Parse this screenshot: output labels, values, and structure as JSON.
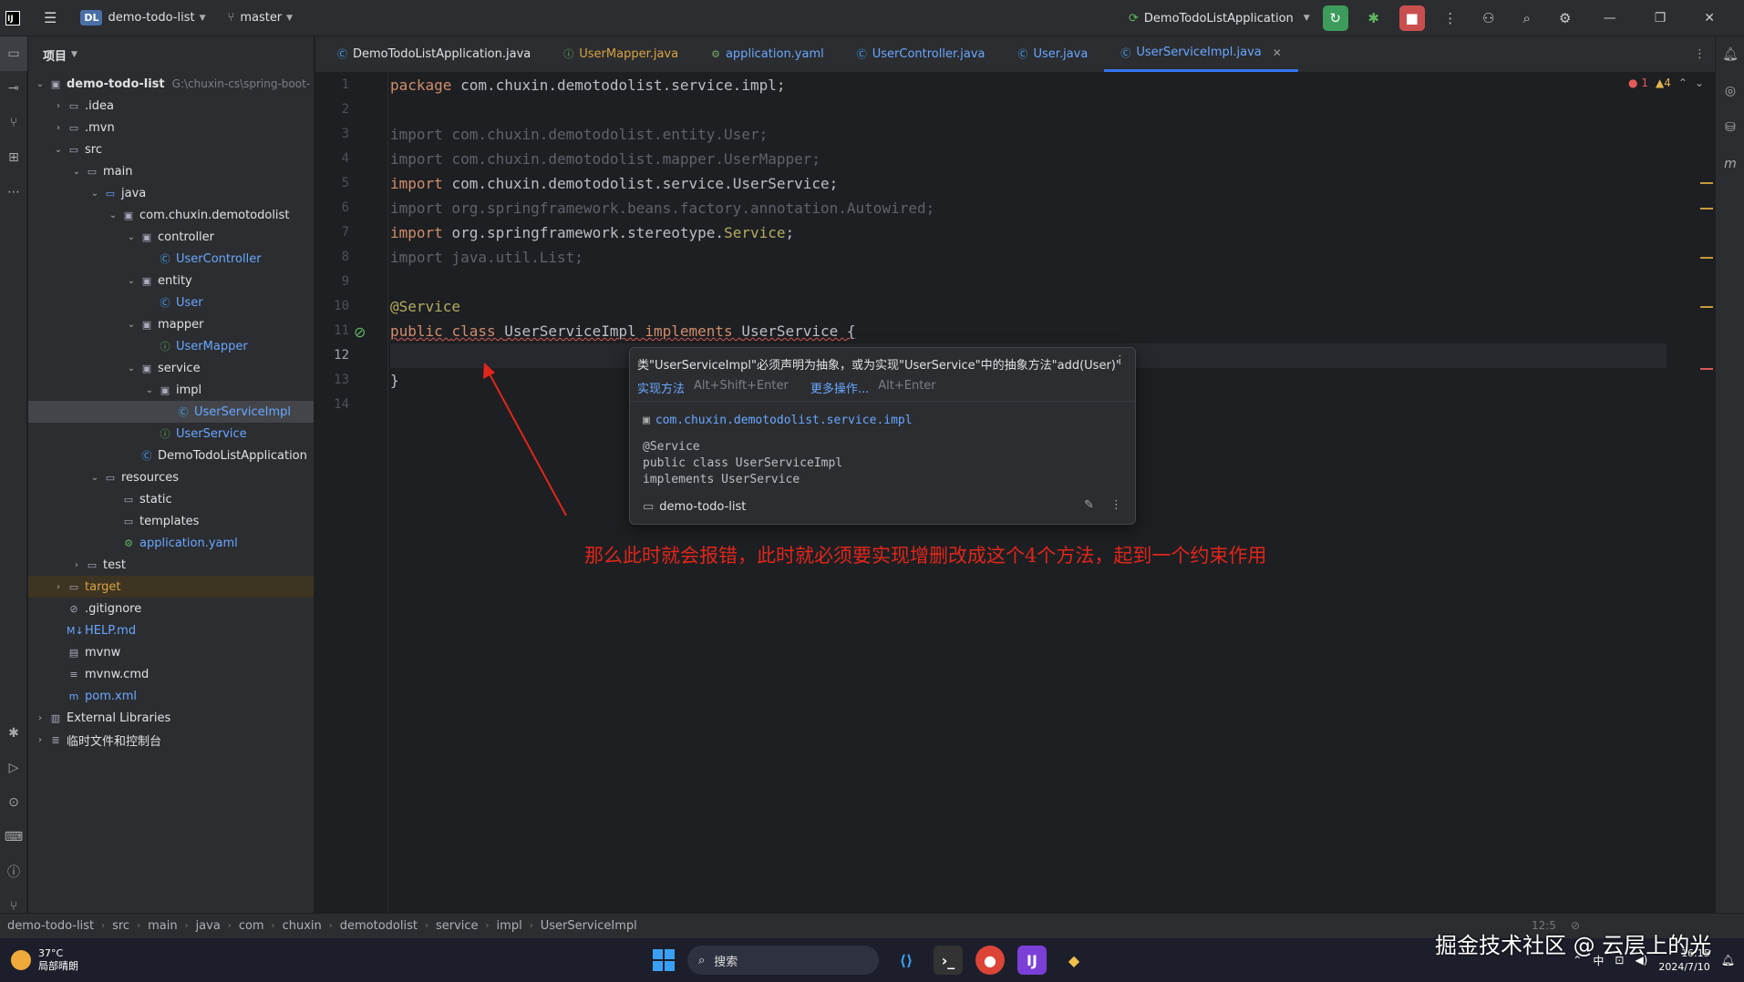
{
  "titlebar": {
    "project_badge": "DL",
    "project_name": "demo-todo-list",
    "branch": "master",
    "run_config": "DemoTodoListApplication"
  },
  "project_panel": {
    "title": "项目",
    "tree": [
      {
        "indent": 0,
        "chev": "v",
        "icon": "module-folder-icon",
        "label": "demo-todo-list",
        "extra": "G:\\chuxin-cs\\spring-boot-",
        "style": "bold"
      },
      {
        "indent": 1,
        "chev": ">",
        "icon": "folder-icon",
        "label": ".idea"
      },
      {
        "indent": 1,
        "chev": ">",
        "icon": "folder-icon",
        "label": ".mvn"
      },
      {
        "indent": 1,
        "chev": "v",
        "icon": "folder-icon",
        "label": "src"
      },
      {
        "indent": 2,
        "chev": "v",
        "icon": "folder-icon",
        "label": "main"
      },
      {
        "indent": 3,
        "chev": "v",
        "icon": "source-folder-icon",
        "label": "java"
      },
      {
        "indent": 4,
        "chev": "v",
        "icon": "package-icon",
        "label": "com.chuxin.demotodolist"
      },
      {
        "indent": 5,
        "chev": "v",
        "icon": "package-icon",
        "label": "controller"
      },
      {
        "indent": 6,
        "chev": "",
        "icon": "class-icon",
        "label": "UserController",
        "style": "blue"
      },
      {
        "indent": 5,
        "chev": "v",
        "icon": "package-icon",
        "label": "entity"
      },
      {
        "indent": 6,
        "chev": "",
        "icon": "class-icon",
        "label": "User",
        "style": "blue"
      },
      {
        "indent": 5,
        "chev": "v",
        "icon": "package-icon",
        "label": "mapper"
      },
      {
        "indent": 6,
        "chev": "",
        "icon": "interface-icon",
        "label": "UserMapper",
        "style": "blue"
      },
      {
        "indent": 5,
        "chev": "v",
        "icon": "package-icon",
        "label": "service"
      },
      {
        "indent": 6,
        "chev": "v",
        "icon": "package-icon",
        "label": "impl"
      },
      {
        "indent": 7,
        "chev": "",
        "icon": "class-icon",
        "label": "UserServiceImpl",
        "style": "blue",
        "selected": true
      },
      {
        "indent": 6,
        "chev": "",
        "icon": "interface-icon",
        "label": "UserService",
        "style": "blue"
      },
      {
        "indent": 5,
        "chev": "",
        "icon": "spring-class-icon",
        "label": "DemoTodoListApplication"
      },
      {
        "indent": 3,
        "chev": "v",
        "icon": "resources-folder-icon",
        "label": "resources"
      },
      {
        "indent": 4,
        "chev": "",
        "icon": "folder-icon",
        "label": "static"
      },
      {
        "indent": 4,
        "chev": "",
        "icon": "folder-icon",
        "label": "templates"
      },
      {
        "indent": 4,
        "chev": "",
        "icon": "yaml-icon",
        "label": "application.yaml",
        "style": "blue"
      },
      {
        "indent": 2,
        "chev": ">",
        "icon": "folder-icon",
        "label": "test"
      },
      {
        "indent": 1,
        "chev": ">",
        "icon": "folder-icon",
        "label": "target",
        "style": "orange",
        "target": true
      },
      {
        "indent": 1,
        "chev": "",
        "icon": "ignore-icon",
        "label": ".gitignore"
      },
      {
        "indent": 1,
        "chev": "",
        "icon": "markdown-icon",
        "label": "HELP.md",
        "style": "blue"
      },
      {
        "indent": 1,
        "chev": "",
        "icon": "file-icon",
        "label": "mvnw"
      },
      {
        "indent": 1,
        "chev": "",
        "icon": "text-icon",
        "label": "mvnw.cmd"
      },
      {
        "indent": 1,
        "chev": "",
        "icon": "maven-icon",
        "label": "pom.xml",
        "style": "blue"
      },
      {
        "indent": 0,
        "chev": ">",
        "icon": "library-icon",
        "label": "External Libraries"
      },
      {
        "indent": 0,
        "chev": ">",
        "icon": "scratch-icon",
        "label": "临时文件和控制台"
      }
    ]
  },
  "tabs": [
    {
      "label": "DemoTodoListApplication.java",
      "icon": "spring-class-icon"
    },
    {
      "label": "UserMapper.java",
      "icon": "interface-icon",
      "style": "orange"
    },
    {
      "label": "application.yaml",
      "icon": "yaml-icon",
      "style": "blue"
    },
    {
      "label": "UserController.java",
      "icon": "class-icon",
      "style": "blue"
    },
    {
      "label": "User.java",
      "icon": "class-icon",
      "style": "blue"
    },
    {
      "label": "UserServiceImpl.java",
      "icon": "class-icon",
      "active": true
    }
  ],
  "editor": {
    "current_line": 12,
    "error_count": "1",
    "warning_count": "4",
    "lines": [
      [
        {
          "t": "package ",
          "c": "kw"
        },
        {
          "t": "com.chuxin.demotodolist.service.impl;"
        }
      ],
      [],
      [
        {
          "t": "import com.chuxin.demotodolist.entity.User;",
          "c": "dim"
        }
      ],
      [
        {
          "t": "import com.chuxin.demotodolist.mapper.UserMapper;",
          "c": "dim"
        }
      ],
      [
        {
          "t": "import ",
          "c": "kw"
        },
        {
          "t": "com.chuxin.demotodolist.service.UserService;"
        }
      ],
      [
        {
          "t": "import org.springframework.beans.factory.annotation.Autowired;",
          "c": "dim"
        }
      ],
      [
        {
          "t": "import ",
          "c": "kw"
        },
        {
          "t": "org.springframework.stereotype."
        },
        {
          "t": "Service",
          "c": "ann"
        },
        {
          "t": ";"
        }
      ],
      [
        {
          "t": "import java.util.List;",
          "c": "dim"
        }
      ],
      [],
      [
        {
          "t": "@Service",
          "c": "ann"
        }
      ],
      [
        {
          "t": "public ",
          "c": "kw strike"
        },
        {
          "t": "class ",
          "c": "kw strike"
        },
        {
          "t": "UserServiceImpl ",
          "c": "strike"
        },
        {
          "t": "implements ",
          "c": "kw strike"
        },
        {
          "t": "UserService {",
          "c": "strike"
        }
      ],
      [],
      [
        {
          "t": "}"
        }
      ],
      []
    ]
  },
  "popup": {
    "message": "类\"UserServiceImpl\"必须声明为抽象，或为实现\"UserService\"中的抽象方法\"add(User)\"",
    "action1": "实现方法",
    "action1_key": "Alt+Shift+Enter",
    "action2": "更多操作...",
    "action2_key": "Alt+Enter",
    "package": "com.chuxin.demotodolist.service.impl",
    "code": "@Service\npublic class UserServiceImpl\nimplements UserService",
    "module": "demo-todo-list"
  },
  "annotation_text": "那么此时就会报错，此时就必须要实现增删改成这个4个方法，起到一个约束作用",
  "breadcrumb": [
    "demo-todo-list",
    "src",
    "main",
    "java",
    "com",
    "chuxin",
    "demotodolist",
    "service",
    "impl",
    "UserServiceImpl"
  ],
  "status": {
    "position": "12:5"
  },
  "taskbar": {
    "temperature": "37°C",
    "weather": "局部晴朗",
    "search_placeholder": "搜索",
    "ime": "中",
    "time": "16:15",
    "date": "2024/7/10"
  },
  "watermark": "掘金技术社区 @ 云层上的光"
}
